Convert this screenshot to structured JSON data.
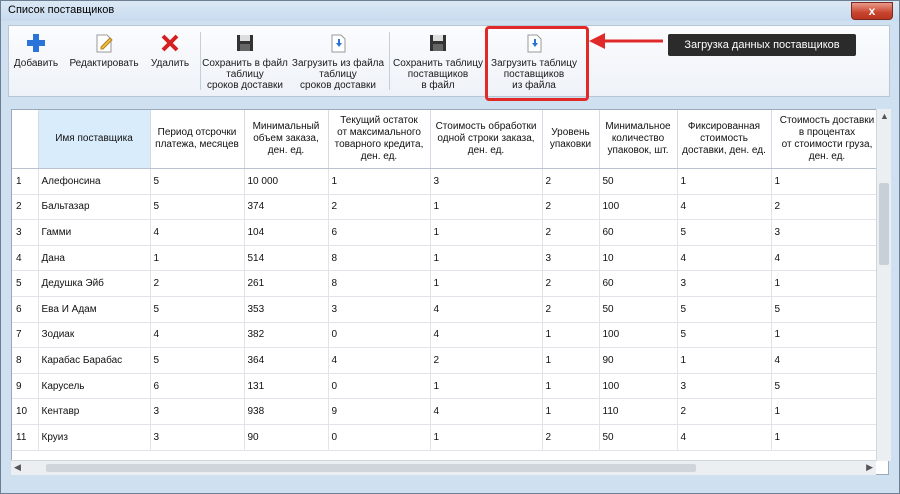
{
  "window": {
    "title": "Список поставщиков",
    "close": "x"
  },
  "toolbar": {
    "add": "Добавить",
    "edit": "Редактировать",
    "delete": "Удалить",
    "save_delivery": [
      "Сохранить в файл",
      "таблицу",
      "сроков доставки"
    ],
    "load_delivery": [
      "Загрузить из файла",
      "таблицу",
      "сроков доставки"
    ],
    "save_suppliers": [
      "Сохранить таблицу",
      "поставщиков",
      "в файл"
    ],
    "load_suppliers": [
      "Загрузить таблицу",
      "поставщиков",
      "из файла"
    ]
  },
  "callout": {
    "tooltip": "Загрузка данных поставщиков"
  },
  "table": {
    "headers": [
      [
        "Имя поставщика"
      ],
      [
        "Период отсрочки",
        "платежа, месяцев"
      ],
      [
        "Минимальный",
        "объем заказа,",
        "ден. ед."
      ],
      [
        "Текущий остаток",
        "от максимального",
        "товарного кредита,",
        "ден. ед."
      ],
      [
        "Стоимость обработки",
        "одной строки заказа,",
        "ден. ед."
      ],
      [
        "Уровень",
        "упаковки"
      ],
      [
        "Минимальное",
        "количество",
        "упаковок, шт."
      ],
      [
        "Фиксированная",
        "стоимость",
        "доставки, ден. ед."
      ],
      [
        "Стоимость доставки",
        "в процентах",
        "от стоимости груза,",
        "ден. ед."
      ]
    ],
    "rows": [
      [
        "1",
        "Алефонсина",
        "5",
        "10 000",
        "1",
        "3",
        "2",
        "50",
        "1",
        "1"
      ],
      [
        "2",
        "Бальтазар",
        "5",
        "374",
        "2",
        "1",
        "2",
        "100",
        "4",
        "2"
      ],
      [
        "3",
        "Гамми",
        "4",
        "104",
        "6",
        "1",
        "2",
        "60",
        "5",
        "3"
      ],
      [
        "4",
        "Дана",
        "1",
        "514",
        "8",
        "1",
        "3",
        "10",
        "4",
        "4"
      ],
      [
        "5",
        "Дедушка Эйб",
        "2",
        "261",
        "8",
        "1",
        "2",
        "60",
        "3",
        "1"
      ],
      [
        "6",
        "Ева И Адам",
        "5",
        "353",
        "3",
        "4",
        "2",
        "50",
        "5",
        "5"
      ],
      [
        "7",
        "Зодиак",
        "4",
        "382",
        "0",
        "4",
        "1",
        "100",
        "5",
        "1"
      ],
      [
        "8",
        "Карабас Барабас",
        "5",
        "364",
        "4",
        "2",
        "1",
        "90",
        "1",
        "4"
      ],
      [
        "9",
        "Карусель",
        "6",
        "131",
        "0",
        "1",
        "1",
        "100",
        "3",
        "5"
      ],
      [
        "10",
        "Кентавр",
        "3",
        "938",
        "9",
        "4",
        "1",
        "110",
        "2",
        "1"
      ],
      [
        "11",
        "Круиз",
        "3",
        "90",
        "0",
        "1",
        "2",
        "50",
        "4",
        "1"
      ]
    ]
  },
  "colors": {
    "accent_red": "#e02a2a",
    "tooltip_bg": "#2b2b2b",
    "sorted_header": "#d9ecfb"
  }
}
